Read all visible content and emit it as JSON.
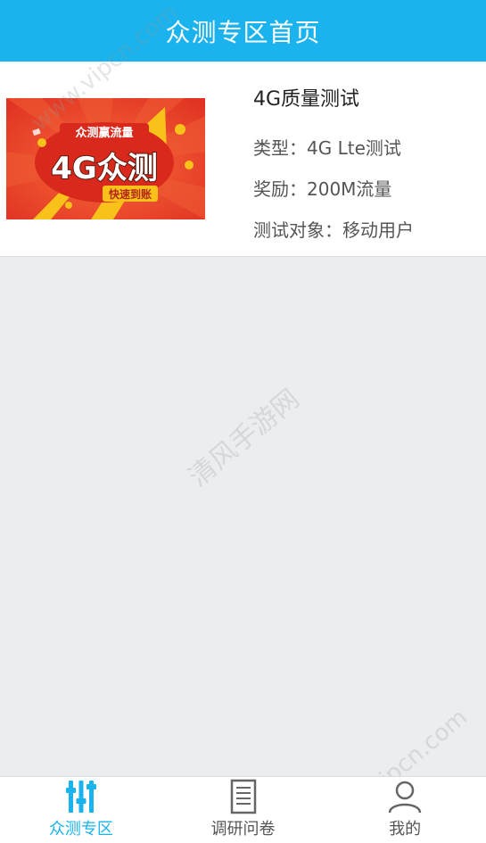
{
  "header": {
    "title": "众测专区首页"
  },
  "task": {
    "title": "4G质量测试",
    "type_line": "类型：4G Lte测试",
    "reward_line": "奖励：200M流量",
    "target_line": "测试对象：移动用户"
  },
  "banner": {
    "top_text": "众测赢流量",
    "main_text": "4G众测",
    "sub_text": "快速到账"
  },
  "tabs": [
    {
      "label": "众测专区",
      "icon": "equalizer-icon",
      "active": true
    },
    {
      "label": "调研问卷",
      "icon": "document-icon",
      "active": false
    },
    {
      "label": "我的",
      "icon": "user-icon",
      "active": false
    }
  ],
  "watermarks": {
    "top": "www.vipcn.com",
    "bottom": "www.vipcn.com",
    "center": "清风手游网"
  },
  "colors": {
    "accent": "#1ab3ee",
    "banner_bg": "#e8402a",
    "banner_yellow": "#f8c21a"
  }
}
